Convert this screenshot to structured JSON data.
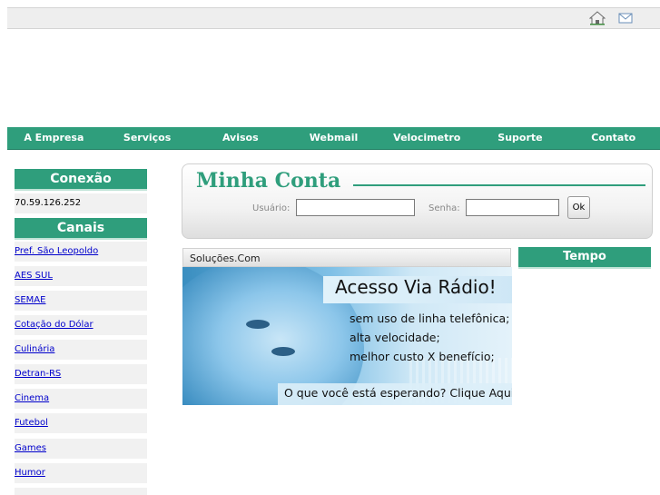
{
  "topbar": {
    "icons": [
      "home-icon",
      "mail-icon"
    ]
  },
  "nav": [
    "A Empresa",
    "Serviços",
    "Avisos",
    "Webmail",
    "Velocimetro",
    "Suporte",
    "Contato"
  ],
  "sidebar": {
    "conexao_title": "Conexão",
    "ip": "70.59.126.252",
    "canais_title": "Canais",
    "canais": [
      "Pref. São Leopoldo",
      "AES SUL",
      "SEMAE",
      "Cotação do Dólar",
      "Culinária",
      "Detran-RS",
      "Cinema",
      "Futebol",
      "Games",
      "Humor"
    ]
  },
  "conta": {
    "title": "Minha Conta",
    "usuario_label": "Usuário:",
    "senha_label": "Senha:",
    "ok_label": "Ok"
  },
  "solucoes": {
    "header": "Soluções.Com",
    "banner_title": "Acesso Via Rádio!",
    "banner_lines": [
      "sem uso de linha telefônica;",
      "alta velocidade;",
      "melhor custo X benefício;"
    ],
    "banner_cta": "O que você está esperando? Clique Aqui!"
  },
  "tempo": {
    "title": "Tempo"
  },
  "colors": {
    "accent": "#2f9e7c",
    "link": "#0000cc"
  }
}
